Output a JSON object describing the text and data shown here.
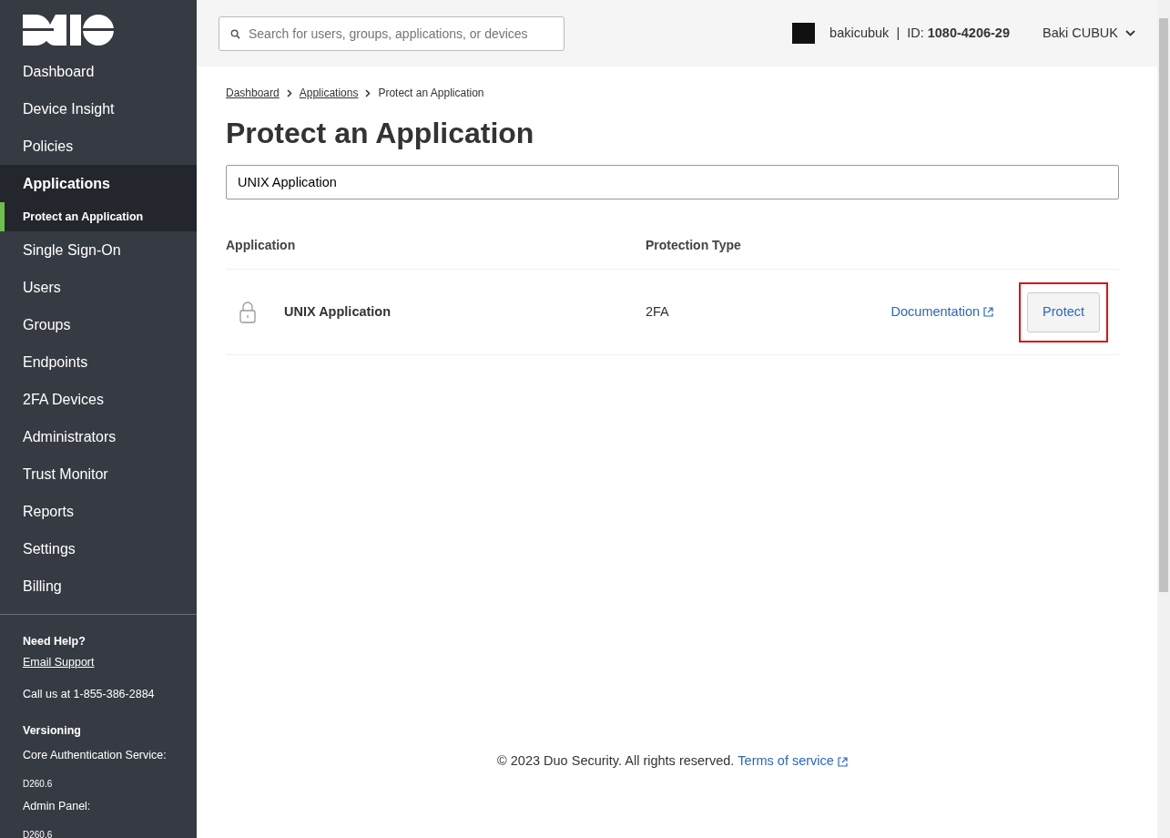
{
  "sidebar": {
    "nav": [
      {
        "label": "Dashboard",
        "selected": false
      },
      {
        "label": "Device Insight",
        "selected": false
      },
      {
        "label": "Policies",
        "selected": false
      },
      {
        "label": "Applications",
        "selected": true,
        "children": [
          {
            "label": "Protect an Application",
            "selected": true
          }
        ]
      },
      {
        "label": "Single Sign-On",
        "selected": false
      },
      {
        "label": "Users",
        "selected": false
      },
      {
        "label": "Groups",
        "selected": false
      },
      {
        "label": "Endpoints",
        "selected": false
      },
      {
        "label": "2FA Devices",
        "selected": false
      },
      {
        "label": "Administrators",
        "selected": false
      },
      {
        "label": "Trust Monitor",
        "selected": false
      },
      {
        "label": "Reports",
        "selected": false
      },
      {
        "label": "Settings",
        "selected": false
      },
      {
        "label": "Billing",
        "selected": false
      }
    ],
    "help": {
      "heading": "Need Help?",
      "link": "Email Support",
      "phone": "Call us at 1-855-386-2884"
    },
    "versioning": {
      "heading": "Versioning",
      "items": [
        {
          "label": "Core Authentication Service:",
          "value": "D260.6"
        },
        {
          "label": "Admin Panel:",
          "value": "D260.6"
        }
      ]
    }
  },
  "header": {
    "search": {
      "placeholder": "Search for users, groups, applications, or devices"
    },
    "account": "bakicubuk",
    "separator": "|",
    "id_label": "ID:",
    "id_value": "1080-4206-29",
    "user": "Baki CUBUK"
  },
  "breadcrumbs": [
    {
      "label": "Dashboard",
      "link": true
    },
    {
      "label": "Applications",
      "link": true
    },
    {
      "label": "Protect an Application",
      "link": false
    }
  ],
  "title": "Protect an Application",
  "filter": {
    "value": "UNIX Application"
  },
  "table": {
    "columns": [
      "Application",
      "Protection Type"
    ],
    "rows": [
      {
        "name": "UNIX Application",
        "protection_type": "2FA",
        "link": "Documentation",
        "button": "Protect",
        "highlighted": true
      }
    ]
  },
  "footer": {
    "copyright": "© 2023 Duo Security. All rights reserved.",
    "link": "Terms of service"
  }
}
